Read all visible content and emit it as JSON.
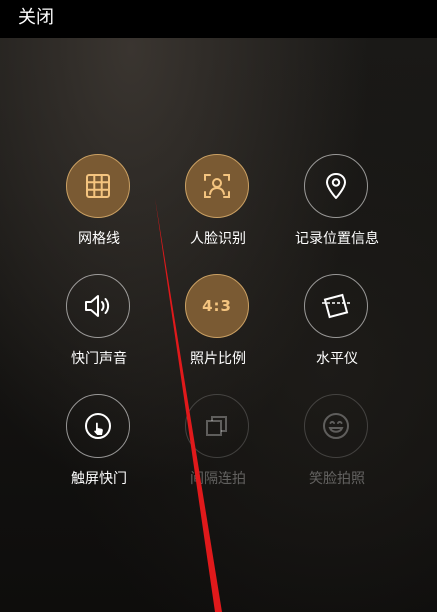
{
  "header": {
    "close_label": "关闭"
  },
  "settings": {
    "grid_lines": "网格线",
    "face_detect": "人脸识别",
    "record_location": "记录位置信息",
    "shutter_sound": "快门声音",
    "photo_ratio": "照片比例",
    "photo_ratio_value": "4:3",
    "level": "水平仪",
    "touch_shutter": "触屏快门",
    "interval_burst": "间隔连拍",
    "smile_shot": "笑脸拍照"
  },
  "colors": {
    "accent": "#caa063",
    "accent_fill": "#7a5a33",
    "annotation": "#e0191b"
  },
  "icons": {
    "grid_lines": "grid-icon",
    "face_detect": "face-scan-icon",
    "record_location": "location-pin-icon",
    "shutter_sound": "speaker-icon",
    "photo_ratio": "aspect-ratio-icon",
    "level": "level-icon",
    "touch_shutter": "touch-icon",
    "interval_burst": "burst-icon",
    "smile_shot": "smile-icon"
  }
}
